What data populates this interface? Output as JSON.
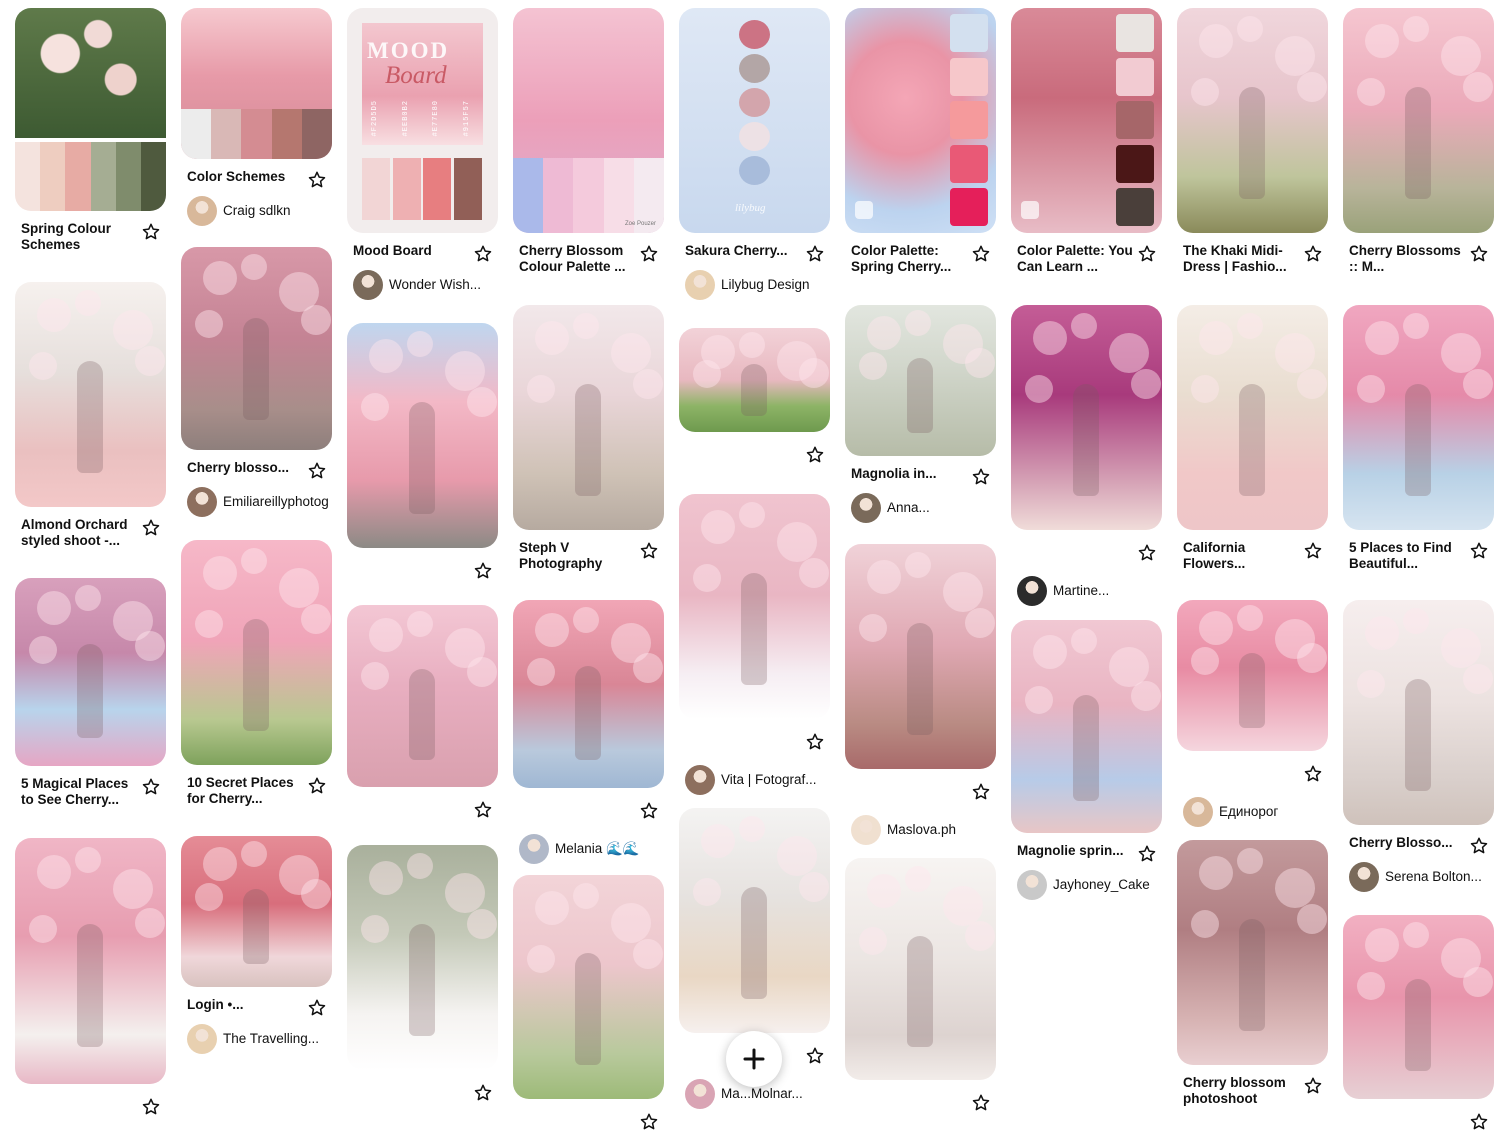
{
  "board": {
    "pins": [
      {
        "title": "Spring Colour Schemes",
        "attribution": null
      },
      {
        "title": "Color Schemes",
        "attribution": "Craig sdlkn"
      },
      {
        "title": "Mood Board",
        "attribution": "Wonder Wish..."
      },
      {
        "title": "Cherry Blossom Colour Palette ...",
        "attribution": null
      },
      {
        "title": "Sakura Cherry...",
        "attribution": "Lilybug Design"
      },
      {
        "title": "Color Palette: Spring Cherry...",
        "attribution": null
      },
      {
        "title": "Color Palette: You Can Learn ...",
        "attribution": null
      },
      {
        "title": "The Khaki Midi-Dress | Fashio...",
        "attribution": null
      },
      {
        "title": "Cherry Blossoms :: M...",
        "attribution": null
      },
      {
        "title": "Almond Orchard styled shoot -...",
        "attribution": null
      },
      {
        "title": "Cherry blosso...",
        "attribution": "Emiliareillyphotog"
      },
      {
        "title": "",
        "attribution": null
      },
      {
        "title": "Steph V Photography",
        "attribution": null
      },
      {
        "title": "",
        "attribution": null
      },
      {
        "title": "Magnolia in...",
        "attribution": "Anna..."
      },
      {
        "title": "",
        "attribution": "Martine..."
      },
      {
        "title": "California Flowers...",
        "attribution": null
      },
      {
        "title": "5 Places to Find Beautiful...",
        "attribution": null
      },
      {
        "title": "5 Magical Places to See Cherry...",
        "attribution": null
      },
      {
        "title": "10 Secret Places for Cherry...",
        "attribution": null
      },
      {
        "title": "",
        "attribution": null
      },
      {
        "title": "",
        "attribution": "Melania 🌊🌊"
      },
      {
        "title": "",
        "attribution": "Vita | Fotograf..."
      },
      {
        "title": "",
        "attribution": "Maslova.ph"
      },
      {
        "title": "Magnolie sprin...",
        "attribution": "Jayhoney_Cake"
      },
      {
        "title": "",
        "attribution": "Единорог"
      },
      {
        "title": "Cherry Blosso...",
        "attribution": "Serena Bolton..."
      },
      {
        "title": "",
        "attribution": null
      },
      {
        "title": "Login •...",
        "attribution": "The Travelling..."
      },
      {
        "title": "",
        "attribution": null
      },
      {
        "title": "",
        "attribution": null
      },
      {
        "title": "",
        "attribution": "Ma...Molnar..."
      },
      {
        "title": "",
        "attribution": null
      },
      {
        "title": "Cherry blossom photoshoot",
        "attribution": null
      },
      {
        "title": "",
        "attribution": null
      }
    ],
    "image_text": {
      "mood_title": "MOOD",
      "mood_script": "Board",
      "mood_hex": [
        "#F2D5D5",
        "#EEB0B2",
        "#E77E80",
        "#915F57"
      ],
      "palette_credit": "Zoe Pouzer",
      "lilybug_mark": "lilybug"
    },
    "icons": {
      "save": "star-outline-icon",
      "create": "plus-icon"
    },
    "colors": {
      "blossom_pink": "#f0a8b8",
      "sky_blue": "#c9daf0",
      "foliage_green": "#6e8f4a",
      "title_text": "#111111"
    }
  }
}
